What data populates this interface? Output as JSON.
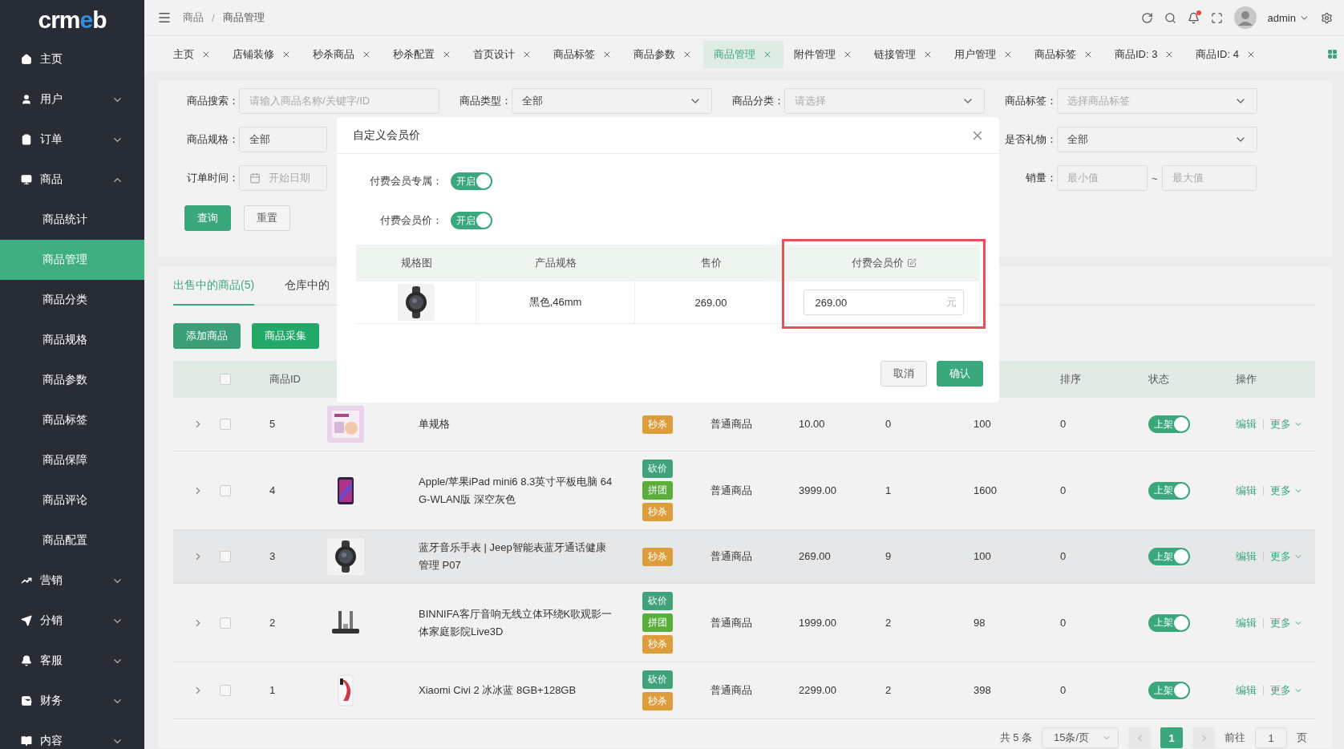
{
  "sidebar": {
    "logo": "crmeb",
    "items": [
      {
        "label": "主页",
        "kind": "link"
      },
      {
        "label": "用户",
        "kind": "group",
        "expanded": false
      },
      {
        "label": "订单",
        "kind": "group",
        "expanded": false
      },
      {
        "label": "商品",
        "kind": "group",
        "expanded": true,
        "children": [
          {
            "label": "商品统计",
            "selected": false
          },
          {
            "label": "商品管理",
            "selected": true
          },
          {
            "label": "商品分类",
            "selected": false
          },
          {
            "label": "商品规格",
            "selected": false
          },
          {
            "label": "商品参数",
            "selected": false
          },
          {
            "label": "商品标签",
            "selected": false
          },
          {
            "label": "商品保障",
            "selected": false
          },
          {
            "label": "商品评论",
            "selected": false
          },
          {
            "label": "商品配置",
            "selected": false
          }
        ]
      },
      {
        "label": "营销",
        "kind": "group",
        "expanded": false
      },
      {
        "label": "分销",
        "kind": "group",
        "expanded": false
      },
      {
        "label": "客服",
        "kind": "group",
        "expanded": false
      },
      {
        "label": "财务",
        "kind": "group",
        "expanded": false
      },
      {
        "label": "内容",
        "kind": "group",
        "expanded": false
      }
    ]
  },
  "header": {
    "breadcrumb": [
      "商品",
      "商品管理"
    ],
    "separator": "/",
    "user": "admin",
    "notification_dot": true
  },
  "tabs": [
    {
      "label": "主页",
      "selected": false
    },
    {
      "label": "店铺装修",
      "selected": false
    },
    {
      "label": "秒杀商品",
      "selected": false
    },
    {
      "label": "秒杀配置",
      "selected": false
    },
    {
      "label": "首页设计",
      "selected": false
    },
    {
      "label": "商品标签",
      "selected": false
    },
    {
      "label": "商品参数",
      "selected": false
    },
    {
      "label": "商品管理",
      "selected": true
    },
    {
      "label": "附件管理",
      "selected": false
    },
    {
      "label": "链接管理",
      "selected": false
    },
    {
      "label": "用户管理",
      "selected": false
    },
    {
      "label": "商品标签",
      "selected": false
    },
    {
      "label": "商品ID: 3",
      "selected": false
    },
    {
      "label": "商品ID: 4",
      "selected": false
    }
  ],
  "filters": [
    [
      {
        "label": "商品搜索：",
        "kind": "input",
        "placeholder": "请输入商品名称/关键字/ID"
      },
      {
        "label": "商品类型：",
        "kind": "select",
        "value": "全部"
      },
      {
        "label": "商品分类：",
        "kind": "select",
        "placeholder": "请选择"
      },
      {
        "label": "商品标签：",
        "kind": "select",
        "placeholder": "选择商品标签"
      }
    ],
    [
      {
        "label": "商品规格：",
        "kind": "input",
        "value": "全部"
      },
      {
        "label": "是否礼物：",
        "kind": "select",
        "value": "全部"
      }
    ],
    [
      {
        "label": "订单时间：",
        "kind": "date",
        "placeholder": "开始日期"
      },
      {
        "label": "销量：",
        "kind": "range",
        "min_placeholder": "最小值",
        "separator": "~",
        "max_placeholder": "最大值"
      }
    ]
  ],
  "filter_buttons": [
    {
      "label": "查询",
      "kind": "primary"
    },
    {
      "label": "重置",
      "kind": "default"
    }
  ],
  "list_tabs": [
    {
      "label": "出售中的商品(5)",
      "selected": true
    },
    {
      "label": "仓库中的",
      "selected": false
    }
  ],
  "list_buttons": [
    {
      "label": "添加商品",
      "color": "#3a9f76"
    },
    {
      "label": "商品采集",
      "color": "#22a869"
    }
  ],
  "table": {
    "all_checked": false,
    "columns": [
      {
        "label": "商品ID"
      },
      {
        "label": "排序"
      },
      {
        "label": "状态"
      },
      {
        "label": "操作"
      }
    ],
    "rows": [
      {
        "id": "5",
        "column_5": "单规格",
        "tags": [
          {
            "label": "秒杀",
            "color": "#dc9d3a"
          }
        ],
        "column_7": "普通商品",
        "column_8": "10.00",
        "column_9": "0",
        "column_10": "100",
        "sort": "0",
        "on": true,
        "status": "上架",
        "edit": "编辑",
        "more": "更多",
        "checked": false,
        "hovered": false
      },
      {
        "id": "4",
        "column_5": "Apple/苹果iPad mini6 8.3英寸平板电脑 64G-WLAN版 深空灰色",
        "tags": [
          {
            "label": "砍价",
            "color": "#3fa27a"
          },
          {
            "label": "拼团",
            "color": "#5aae3c"
          },
          {
            "label": "秒杀",
            "color": "#dc9d3a"
          }
        ],
        "column_7": "普通商品",
        "column_8": "3999.00",
        "column_9": "1",
        "column_10": "1600",
        "sort": "0",
        "on": true,
        "status": "上架",
        "edit": "编辑",
        "more": "更多",
        "checked": false,
        "hovered": false
      },
      {
        "id": "3",
        "column_5": "蓝牙音乐手表 | Jeep智能表蓝牙通话健康管理 P07",
        "tags": [
          {
            "label": "秒杀",
            "color": "#dc9d3a"
          }
        ],
        "column_7": "普通商品",
        "column_8": "269.00",
        "column_9": "9",
        "column_10": "100",
        "sort": "0",
        "on": true,
        "status": "上架",
        "edit": "编辑",
        "more": "更多",
        "checked": false,
        "hovered": true
      },
      {
        "id": "2",
        "column_5": "BINNIFA客厅音响无线立体环绕K歌观影一体家庭影院Live3D",
        "tags": [
          {
            "label": "砍价",
            "color": "#3fa27a"
          },
          {
            "label": "拼团",
            "color": "#5aae3c"
          },
          {
            "label": "秒杀",
            "color": "#dc9d3a"
          }
        ],
        "column_7": "普通商品",
        "column_8": "1999.00",
        "column_9": "2",
        "column_10": "98",
        "sort": "0",
        "on": true,
        "status": "上架",
        "edit": "编辑",
        "more": "更多",
        "checked": false,
        "hovered": false
      },
      {
        "id": "1",
        "column_5": "Xiaomi Civi 2 冰冰蓝 8GB+128GB",
        "tags": [
          {
            "label": "砍价",
            "color": "#3fa27a"
          },
          {
            "label": "秒杀",
            "color": "#dc9d3a"
          }
        ],
        "column_7": "普通商品",
        "column_8": "2299.00",
        "column_9": "2",
        "column_10": "398",
        "sort": "0",
        "on": true,
        "status": "上架",
        "edit": "编辑",
        "more": "更多",
        "checked": false,
        "hovered": false
      }
    ]
  },
  "pagination": {
    "total": "共 5 条",
    "page_size": "15条/页",
    "pages": [
      {
        "label": "1",
        "selected": true
      }
    ],
    "goto_label": "前往",
    "goto_value": "1",
    "goto_suffix": "页"
  },
  "modal": {
    "title": "自定义会员价",
    "switches": [
      {
        "label": "付费会员专属：",
        "on": true,
        "text": "开启"
      },
      {
        "label": "付费会员价：",
        "on": true,
        "text": "开启"
      }
    ],
    "columns": [
      {
        "label": "规格图",
        "editable": false,
        "highlighted": false
      },
      {
        "label": "产品规格",
        "editable": false,
        "highlighted": false
      },
      {
        "label": "售价",
        "editable": false,
        "highlighted": false
      },
      {
        "label": "付费会员价",
        "editable": true,
        "highlighted": true
      }
    ],
    "rows": [
      {
        "cells": [
          {
            "kind": "picture"
          },
          {
            "kind": "text",
            "text": "黑色,46mm"
          },
          {
            "kind": "text",
            "text": "269.00"
          },
          {
            "kind": "input",
            "value": "269.00",
            "suffix": "元"
          }
        ]
      }
    ],
    "buttons": [
      {
        "label": "取消",
        "kind": "default"
      },
      {
        "label": "确认",
        "kind": "primary"
      }
    ]
  }
}
